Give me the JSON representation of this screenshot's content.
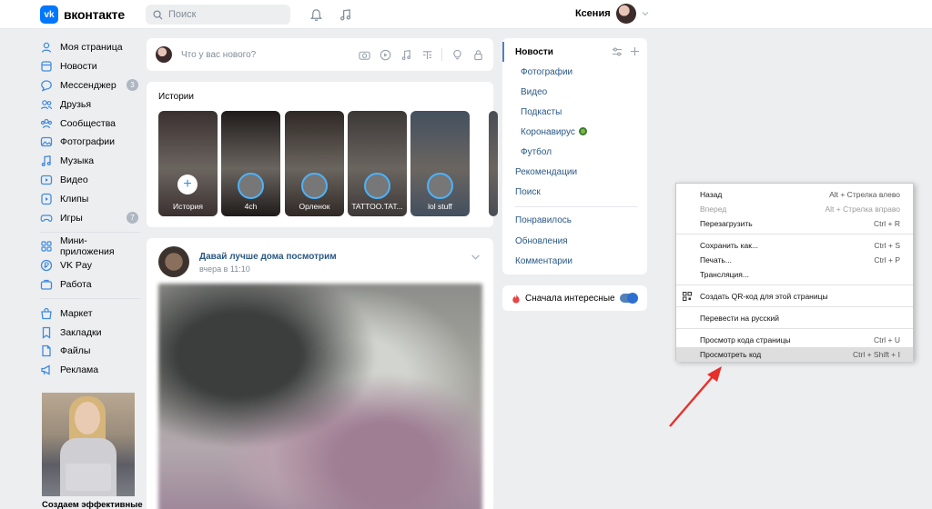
{
  "header": {
    "logo_letters": "vk",
    "logo_text": "вконтакте",
    "search_placeholder": "Поиск",
    "user_name": "Ксения"
  },
  "leftnav": {
    "items": [
      {
        "label": "Моя страница",
        "icon": "user-icon"
      },
      {
        "label": "Новости",
        "icon": "news-icon"
      },
      {
        "label": "Мессенджер",
        "icon": "chat-icon",
        "badge": "3"
      },
      {
        "label": "Друзья",
        "icon": "friends-icon"
      },
      {
        "label": "Сообщества",
        "icon": "communities-icon"
      },
      {
        "label": "Фотографии",
        "icon": "photo-icon"
      },
      {
        "label": "Музыка",
        "icon": "music-icon"
      },
      {
        "label": "Видео",
        "icon": "video-icon"
      },
      {
        "label": "Клипы",
        "icon": "clips-icon"
      },
      {
        "label": "Игры",
        "icon": "games-icon",
        "badge": "7"
      }
    ],
    "items2": [
      {
        "label": "Мини-приложения",
        "icon": "apps-icon"
      },
      {
        "label": "VK Pay",
        "icon": "vkpay-icon"
      },
      {
        "label": "Работа",
        "icon": "briefcase-icon"
      }
    ],
    "items3": [
      {
        "label": "Маркет",
        "icon": "market-icon"
      },
      {
        "label": "Закладки",
        "icon": "bookmark-icon"
      },
      {
        "label": "Файлы",
        "icon": "files-icon"
      },
      {
        "label": "Реклама",
        "icon": "ads-icon"
      }
    ],
    "promo_text": "Создаем эффективные"
  },
  "composer": {
    "placeholder": "Что у вас нового?"
  },
  "stories": {
    "title": "Истории",
    "items": [
      {
        "label": "История",
        "color": "#3b3030"
      },
      {
        "label": "4ch",
        "color": "#1f1b1a"
      },
      {
        "label": "Орленок",
        "color": "#2f2824"
      },
      {
        "label": "TATTOO.TAT...",
        "color": "#3c3836"
      },
      {
        "label": "lol stuff",
        "color": "#43505f"
      },
      {
        "label": "",
        "color": "#4a4c55"
      }
    ]
  },
  "post": {
    "author": "Давай лучше дома посмотрим",
    "time": "вчера в 11:10"
  },
  "filters": {
    "active": "Новости",
    "sub": [
      "Фотографии",
      "Видео",
      "Подкасты",
      "Коронавирус",
      "Футбол"
    ],
    "main": [
      "Рекомендации",
      "Поиск"
    ],
    "extra": [
      "Понравилось",
      "Обновления",
      "Комментарии"
    ]
  },
  "interesting": {
    "label": "Сначала интересные",
    "enabled": true
  },
  "context_menu": {
    "items": [
      {
        "label": "Назад",
        "shortcut": "Alt + Стрелка влево"
      },
      {
        "label": "Вперед",
        "shortcut": "Alt + Стрелка вправо",
        "disabled": true
      },
      {
        "label": "Перезагрузить",
        "shortcut": "Ctrl + R"
      },
      {
        "label": "Сохранить как...",
        "shortcut": "Ctrl + S"
      },
      {
        "label": "Печать...",
        "shortcut": "Ctrl + P"
      },
      {
        "label": "Трансляция...",
        "shortcut": ""
      },
      {
        "label": "Создать QR-код для этой страницы",
        "shortcut": ""
      },
      {
        "label": "Перевести на русский",
        "shortcut": ""
      },
      {
        "label": "Просмотр кода страницы",
        "shortcut": "Ctrl + U"
      },
      {
        "label": "Просмотреть код",
        "shortcut": "Ctrl + Shift + I",
        "highlighted": true
      }
    ]
  },
  "colors": {
    "accent": "#0077ff",
    "link": "#2a5885",
    "arrow": "#e8302a"
  }
}
